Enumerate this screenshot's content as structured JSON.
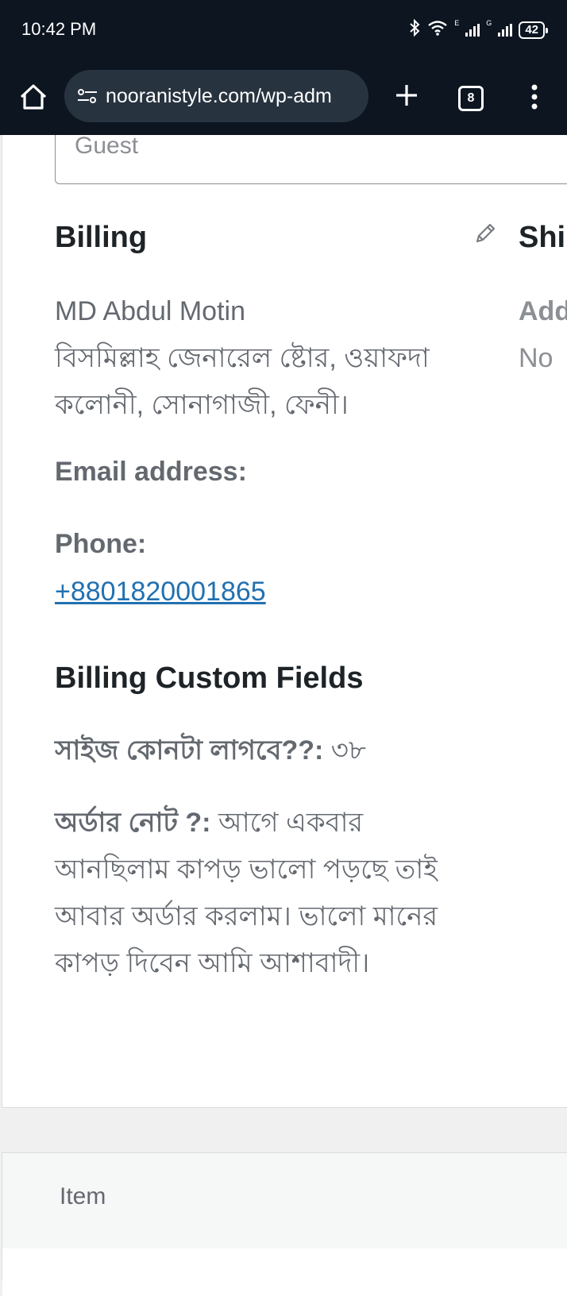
{
  "status_bar": {
    "time": "10:42 PM",
    "battery": "42",
    "network_e": "E",
    "network_g": "G"
  },
  "browser": {
    "url": "nooranistyle.com/wp-adm",
    "tab_count": "8",
    "icons": [
      "home-icon",
      "site-settings-icon",
      "plus-icon",
      "tabs-icon",
      "more-vert-icon"
    ]
  },
  "customer": {
    "guest_value": "Guest"
  },
  "billing": {
    "title": "Billing",
    "name": "MD Abdul Motin",
    "address_line1": "বিসমিল্লাহ জেনারেল ষ্টোর, ওয়াফদা",
    "address_line2": "কলোনী, সোনাগাজী, ফেনী।",
    "email_label": "Email address:",
    "phone_label": "Phone:",
    "phone": "+8801820001865"
  },
  "shipping": {
    "title": "Shi",
    "address_label": "Add",
    "address_value": "No"
  },
  "custom_fields": {
    "title": "Billing Custom Fields",
    "size_label": "সাইজ কোনটা লাগবে??:",
    "size_value": " ৩৮",
    "note_label": "অর্ডার নোট ?:",
    "note_value": " আগে একবার আনছিলাম কাপড় ভালো পড়ছে তাই আবার অর্ডার করলাম। ভালো মানের কাপড় দিবেন আমি আশাবাদী।"
  },
  "items": {
    "header": "Item"
  }
}
